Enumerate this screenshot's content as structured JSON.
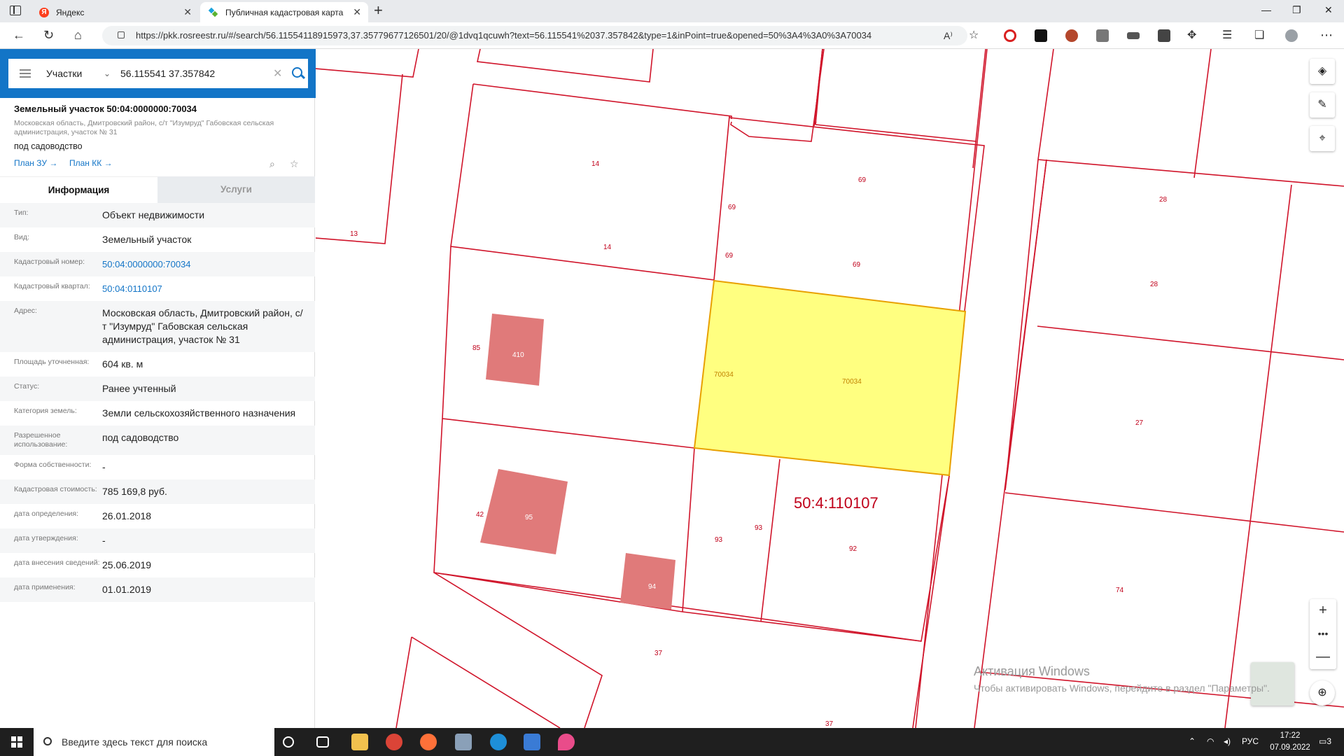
{
  "browser": {
    "tabs": [
      {
        "title": "Яндекс",
        "active": false
      },
      {
        "title": "Публичная кадастровая карта",
        "active": true
      }
    ],
    "url": "https://pkk.rosreestr.ru/#/search/56.11554118915973,37.35779677126501/20/@1dvq1qcuwh?text=56.115541%2037.357842&type=1&inPoint=true&opened=50%3A4%3A0%3A70034"
  },
  "search": {
    "type": "Участки",
    "query": "56.115541 37.357842"
  },
  "object": {
    "title": "Земельный участок 50:04:0000000:70034",
    "address_short": "Московская область, Дмитровский район, с/т \"Изумруд\" Габовская сельская администрация, участок № 31",
    "use": "под садоводство",
    "plan_zu": "План ЗУ",
    "plan_kk": "План КК"
  },
  "tabs": {
    "info": "Информация",
    "services": "Услуги"
  },
  "info_rows": [
    {
      "label": "Тип:",
      "value": "Объект недвижимости"
    },
    {
      "label": "Вид:",
      "value": "Земельный участок"
    },
    {
      "label": "Кадастровый номер:",
      "value": "50:04:0000000:70034",
      "link": true
    },
    {
      "label": "Кадастровый квартал:",
      "value": "50:04:0110107",
      "link": true
    },
    {
      "label": "Адрес:",
      "value": "Московская область, Дмитровский район, с/т \"Изумруд\" Габовская сельская администрация, участок № 31"
    },
    {
      "label": "Площадь уточненная:",
      "value": "604 кв. м"
    },
    {
      "label": "Статус:",
      "value": "Ранее учтенный"
    },
    {
      "label": "Категория земель:",
      "value": "Земли сельскохозяйственного назначения"
    },
    {
      "label": "Разрешенное использование:",
      "value": "под садоводство"
    },
    {
      "label": "Форма собственности:",
      "value": "-"
    },
    {
      "label": "Кадастровая стоимость:",
      "value": "785 169,8 руб."
    },
    {
      "label": "дата определения:",
      "value": "26.01.2018"
    },
    {
      "label": "дата утверждения:",
      "value": "-"
    },
    {
      "label": "дата внесения сведений:",
      "value": "25.06.2019"
    },
    {
      "label": "дата применения:",
      "value": "01.01.2019"
    }
  ],
  "map": {
    "quarter_label": "50:4:110107",
    "labels": [
      "14",
      "14",
      "69",
      "69",
      "69",
      "69",
      "13",
      "85",
      "410",
      "70034",
      "70034",
      "28",
      "28",
      "27",
      "42",
      "95",
      "93",
      "93",
      "92",
      "94",
      "74",
      "37",
      "37"
    ],
    "colors": {
      "boundary": "#d0142a",
      "selected_fill": "#ffff80",
      "selected_stroke": "#e8a000",
      "building": "#e07a7a",
      "label": "#c0001a"
    }
  },
  "watermark": {
    "title": "Активация Windows",
    "text": "Чтобы активировать Windows, перейдите в раздел \"Параметры\"."
  },
  "taskbar": {
    "search_placeholder": "Введите здесь текст для поиска",
    "lang": "РУС",
    "time": "17:22",
    "date": "07.09.2022",
    "notifications": "3"
  }
}
